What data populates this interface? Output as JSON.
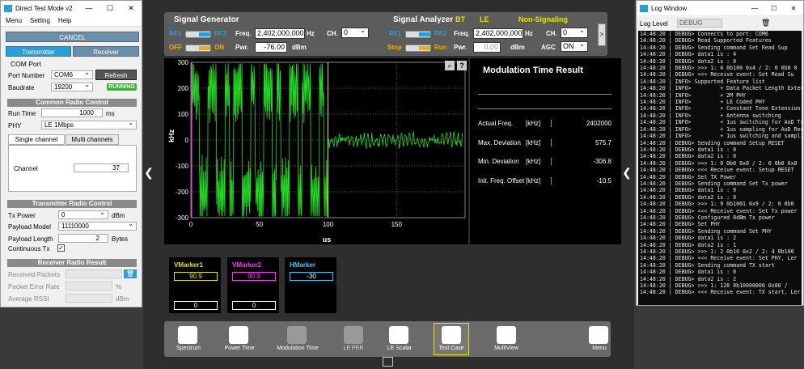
{
  "dtm": {
    "title": "Direct Test Mode v2",
    "menu": [
      "Menu",
      "Setting",
      "Help"
    ],
    "cancel_label": "CANCEL",
    "tab_transmitter": "Transmitter",
    "tab_receiver": "Receiver",
    "com_port_title": "COM Port",
    "port_number_label": "Port Number",
    "port_number_value": "COM6",
    "refresh_label": "Refresh",
    "baudrate_label": "Baudrate",
    "baudrate_value": "19200",
    "running_badge": "RUNNING",
    "common_title": "Common Radio Control",
    "run_time_label": "Run Time",
    "run_time_value": "1000",
    "run_time_unit": "ms",
    "phy_label": "PHY",
    "phy_value": "LE 1Mbps",
    "single_channel_tab": "Single channel",
    "multi_channels_tab": "Multi channels",
    "channel_label": "Channel",
    "channel_value": "37",
    "tx_title": "Transmitter Radio Control",
    "tx_power_label": "Tx Power",
    "tx_power_value": "0",
    "tx_power_unit": "dBm",
    "payload_model_label": "Payload Model",
    "payload_model_value": "11110000",
    "payload_length_label": "Payload Length",
    "payload_length_value": "2",
    "payload_length_unit": "Bytes",
    "continuous_tx_label": "Continuous Tx",
    "rx_title": "Receiver Radio Result",
    "received_packets_label": "Received Packets",
    "packet_error_rate_label": "Packet Error Rate",
    "per_unit": "%",
    "avg_rssi_label": "Average RSSI",
    "rssi_unit": "dBm"
  },
  "sg": {
    "title": "Signal Generator",
    "rf1": "RF1",
    "rf2": "RF2",
    "freq_label": "Freq.",
    "freq_value": "2,402,000,000",
    "freq_unit": "Hz",
    "ch_label": "CH.",
    "ch_value": "0",
    "off": "OFF",
    "on": "ON",
    "pwr_label": "Pwr.",
    "pwr_value": "-76.00",
    "pwr_unit": "dBm"
  },
  "sa": {
    "title": "Signal Analyzer",
    "bt": "BT",
    "le": "LE",
    "mode": "Non-Signaling",
    "rf1": "RF1",
    "rf2": "RF2",
    "freq_label": "Freq.",
    "freq_value": "2,402,000,000",
    "freq_unit": "Hz",
    "ch_label": "CH.",
    "ch_value": "0",
    "stop": "Stop",
    "run": "Run",
    "pwr_label": "Pwr.",
    "pwr_value": "0.00",
    "pwr_unit": "dBm",
    "agc_label": "AGC",
    "agc_value": "ON",
    "next_label": ">"
  },
  "chart_data": {
    "type": "line",
    "xlabel": "us",
    "ylabel": "kHz",
    "xlim": [
      0,
      200
    ],
    "ylim": [
      -300,
      300
    ],
    "x_ticks": [
      "0",
      "50",
      "100",
      "150"
    ],
    "y_ticks": [
      "300",
      "200",
      "100",
      "0",
      "-100",
      "-200",
      "-300"
    ],
    "series": [
      {
        "color": "#22dd22"
      }
    ],
    "description_segments": [
      {
        "x_range": [
          0,
          100
        ],
        "amplitude_khz": 280
      },
      {
        "x_range": [
          100,
          200
        ],
        "amplitude_khz": 30
      }
    ],
    "markers_x": [
      0,
      100
    ]
  },
  "result": {
    "title": "Modulation Time Result",
    "rows": [
      {
        "label": "Actual Freq.",
        "unit": "[kHz]",
        "value": "2402000"
      },
      {
        "label": "Max. Deviation",
        "unit": "[kHz]",
        "value": "575.7"
      },
      {
        "label": "Min. Deviation",
        "unit": "[kHz]",
        "value": "-306.8"
      },
      {
        "label": "Init. Freq. Offset",
        "unit": "[kHz]",
        "value": "-10.5"
      }
    ]
  },
  "markers": [
    {
      "name": "VMarker1",
      "v1": "90.9",
      "v2": "0",
      "color": "#e6e600"
    },
    {
      "name": "VMarker2",
      "v1": "90.9",
      "v2": "0",
      "color": "#ff33ff"
    },
    {
      "name": "HMarker",
      "v1": "-30",
      "v2": "",
      "color": "#33ccff"
    }
  ],
  "dock": {
    "items": [
      "Spectrum",
      "Power Time",
      "Modulation Time",
      "LE PER",
      "LE Scalar",
      "Test Case",
      "MultiView",
      "Menu"
    ]
  },
  "log": {
    "title": "Log Window",
    "level_label": "Log Level",
    "level_value": "DEBUG",
    "lines": [
      "14:48:20 | DEBUG> Connects to port: COM6",
      "14:48:20 | DEBUG> Read Supported Features",
      "14:48:20 | DEBUG> Sending command Set Read Sup",
      "14:48:20 | DEBUG> data1 is : 4",
      "14:48:20 | DEBUG> data2 is : 0",
      "14:48:20 | DEBUG> >>> 1: 4 0b100 0x4 / 2: 0 0b0 0",
      "14:48:20 | DEBUG> <<< Receive event: Set Read Su",
      "14:48:20 | INFO> Supported Feature list",
      "14:48:20 | INFO>         + Data Packet Length Exter",
      "14:48:20 | INFO>         + 2M PHY",
      "14:48:20 | INFO>         + LE Coded PHY",
      "14:48:20 | INFO>         + Constant Tone Extension",
      "14:48:20 | INFO>         + Antenna switching",
      "14:48:20 | INFO>         + 1us switching for AoD Tra",
      "14:48:20 | INFO>         + 1us sampling for AoD Rec",
      "14:48:20 | INFO>         + 1us switching and sampli",
      "14:48:20 | DEBUG> Sending command Setup RESET",
      "14:48:20 | DEBUG> data1 is : 0",
      "14:48:20 | DEBUG> data2 is : 0",
      "14:48:20 | DEBUG> >>> 1: 0 0b0 0x0 / 2: 0 0b0 0x0",
      "14:48:20 | DEBUG> <<< Receive event: Setup RESET",
      "14:48:20 | DEBUG> Set TX Power",
      "14:48:20 | DEBUG> Sending command Set Tx power",
      "14:48:20 | DEBUG> data1 is : 9",
      "14:48:20 | DEBUG> data2 is : 0",
      "14:48:20 | DEBUG> >>> 1: 9 0b1001 0x9 / 2: 0 0b0",
      "14:48:20 | DEBUG> <<< Receive event: Set Tx power",
      "14:48:20 | DEBUG> Configured 0dBm Tx power",
      "14:48:20 | DEBUG> Set PHY",
      "14:48:20 | DEBUG> Sending command Set PHY",
      "14:48:20 | DEBUG> data1 is : 2",
      "14:48:20 | DEBUG> data2 is : 1",
      "14:48:20 | DEBUG> >>> 1: 2 0b10 0x2 / 2: 4 0b100",
      "14:48:20 | DEBUG> <<< Receive event: Set PHY, Ler",
      "14:48:20 | DEBUG> Sending command TX start",
      "14:48:20 | DEBUG> data1 is : 0",
      "14:48:20 | DEBUG> data2 is : 2",
      "14:48:20 | DEBUG> >>> 1: 128 0b10000000 0x80 /",
      "14:48:20 | DEBUG> <<< Receive event: TX start, Ler"
    ]
  }
}
